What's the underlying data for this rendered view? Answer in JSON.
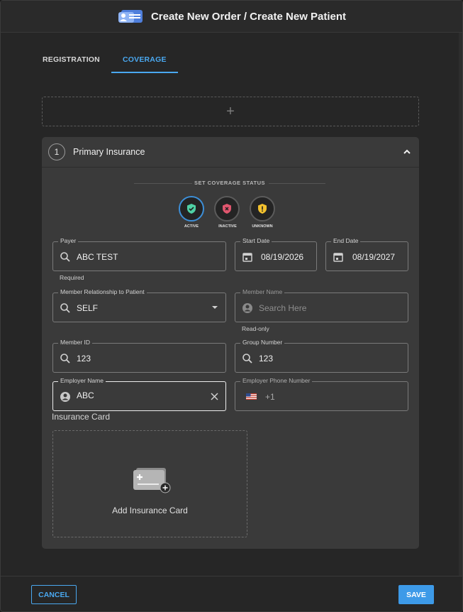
{
  "header": {
    "title": "Create New Order / Create New Patient",
    "logo": "patient-card-icon"
  },
  "tabs": [
    {
      "label": "REGISTRATION",
      "active": false
    },
    {
      "label": "COVERAGE",
      "active": true
    }
  ],
  "add_coverage": {
    "icon": "plus-icon",
    "glyph": "+"
  },
  "insurance": {
    "number": "1",
    "title": "Primary Insurance",
    "expanded": true,
    "coverage_status": {
      "heading": "SET COVERAGE STATUS",
      "options": [
        {
          "label": "ACTIVE",
          "color": "#4fd1a5",
          "icon": "shield-check-icon",
          "selected": true
        },
        {
          "label": "INACTIVE",
          "color": "#e0566e",
          "icon": "shield-x-icon",
          "selected": false
        },
        {
          "label": "UNKNOWN",
          "color": "#f2c12e",
          "icon": "shield-alert-icon",
          "selected": false
        }
      ]
    },
    "payer": {
      "label": "Payer",
      "value": "ABC TEST",
      "helper": "Required"
    },
    "start_date": {
      "label": "Start Date",
      "value": "08/19/2026"
    },
    "end_date": {
      "label": "End Date",
      "value": "08/19/2027"
    },
    "relationship": {
      "label": "Member Relationship to Patient",
      "value": "SELF"
    },
    "member_name": {
      "label": "Member Name",
      "placeholder": "Search Here",
      "helper": "Read-only"
    },
    "member_id": {
      "label": "Member ID",
      "value": "123"
    },
    "group_number": {
      "label": "Group Number",
      "value": "123"
    },
    "employer_name": {
      "label": "Employer Name",
      "value": "ABC"
    },
    "employer_phone": {
      "label": "Employer Phone Number",
      "prefix": "+1",
      "flag": "us-flag-icon"
    },
    "insurance_card": {
      "label": "Insurance Card",
      "action": "Add Insurance Card"
    }
  },
  "footer": {
    "cancel_label": "CANCEL",
    "save_label": "SAVE"
  },
  "colors": {
    "accent": "#4aa8f0",
    "background": "#262626",
    "panel": "#3a3a3a"
  }
}
